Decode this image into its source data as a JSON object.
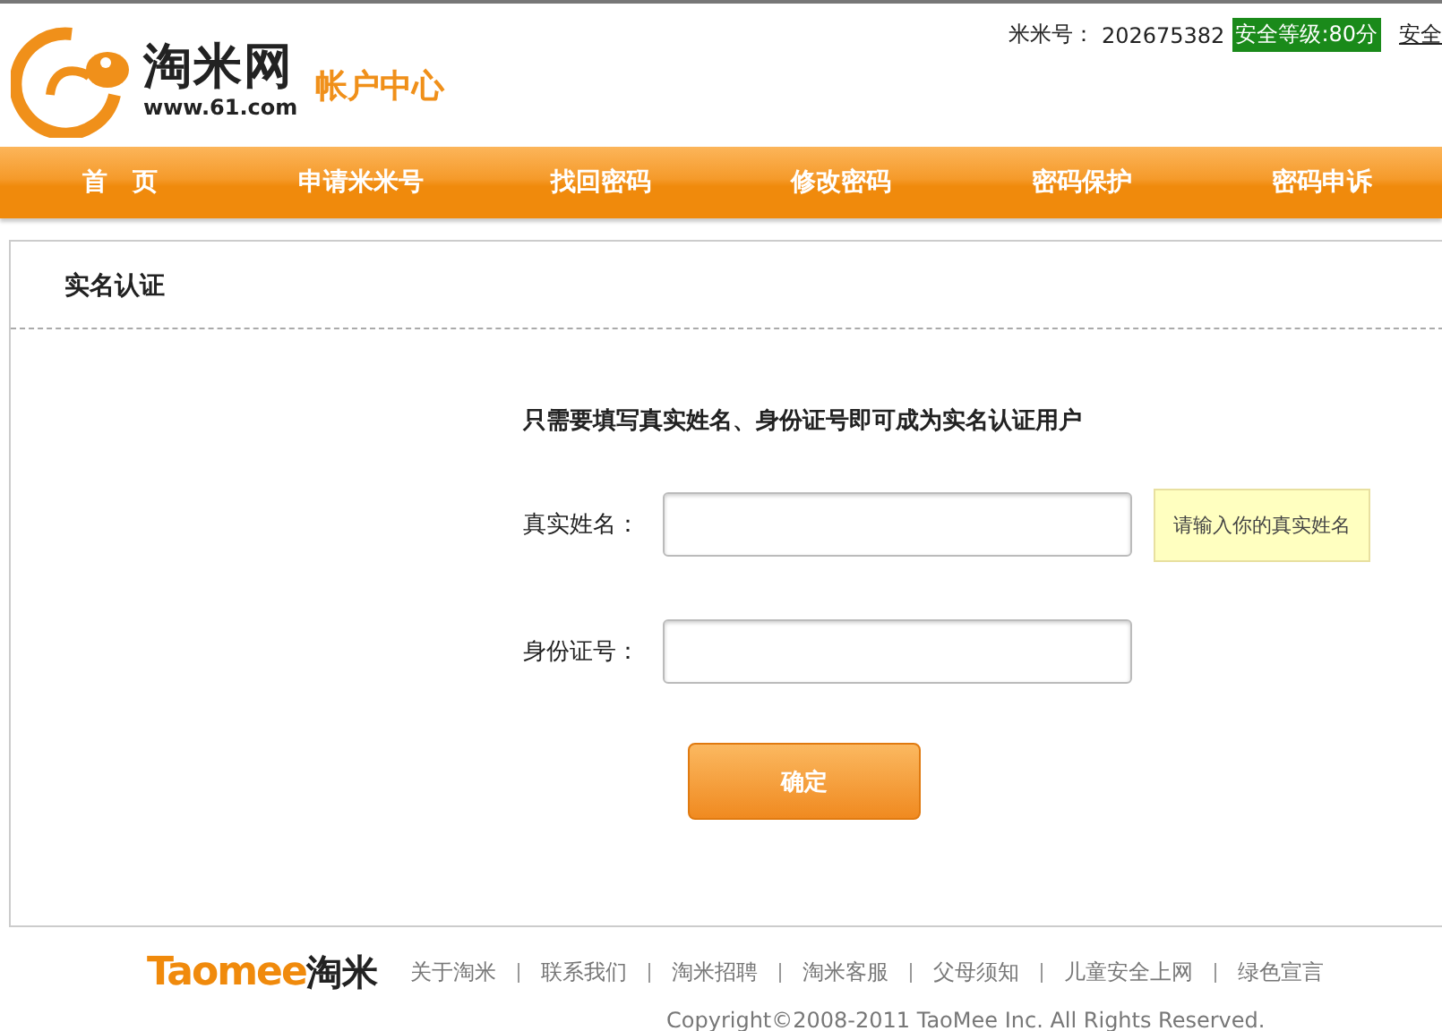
{
  "header": {
    "logo_name": "淘米网",
    "logo_url": "www.61.com",
    "section_title": "帐户中心",
    "account_label": "米米号：",
    "account_number": "202675382",
    "security_badge": "安全等级:80分",
    "security_link": "安全"
  },
  "nav": [
    {
      "label": "首　页"
    },
    {
      "label": "申请米米号"
    },
    {
      "label": "找回密码"
    },
    {
      "label": "修改密码"
    },
    {
      "label": "密码保护"
    },
    {
      "label": "密码申诉"
    }
  ],
  "panel": {
    "title": "实名认证",
    "intro": "只需要填写真实姓名、身份证号即可成为实名认证用户",
    "fields": [
      {
        "label": "真实姓名：",
        "hint": "请输入你的真实姓名"
      },
      {
        "label": "身份证号："
      }
    ],
    "submit": "确定"
  },
  "footer": {
    "brand_latin": "Taomee",
    "brand_cjk": "淘米",
    "links": [
      "关于淘米",
      "联系我们",
      "淘米招聘",
      "淘米客服",
      "父母须知",
      "儿童安全上网",
      "绿色宣言"
    ],
    "copyright": "Copyright©2008-2011 TaoMee Inc. All Rights Reserved."
  }
}
